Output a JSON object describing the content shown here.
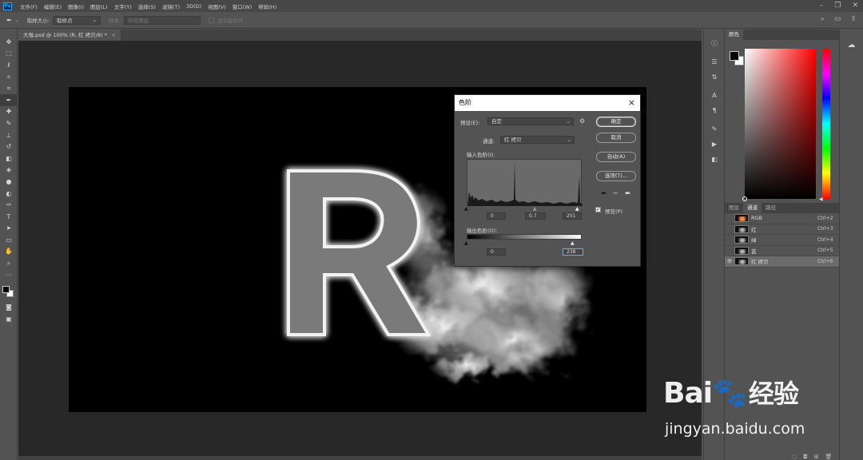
{
  "app": {
    "logo": "Ps",
    "menu": [
      "文件(F)",
      "编辑(E)",
      "图像(I)",
      "图层(L)",
      "文字(Y)",
      "选择(S)",
      "滤镜(T)",
      "3D(D)",
      "视图(V)",
      "窗口(W)",
      "帮助(H)"
    ]
  },
  "options_bar": {
    "sample_size_label": "取样大小:",
    "sample_size_value": "取样点",
    "sample_label": "样本:",
    "sample_value": "所有图层",
    "show_ring": "显示取样环"
  },
  "document": {
    "tab_title": "大咖.psd @ 100% (R, 红 拷贝/8) *",
    "close": "×"
  },
  "tools": [
    "move-icon",
    "marquee-icon",
    "lasso-icon",
    "magic-wand-icon",
    "crop-icon",
    "eyedropper-icon",
    "healing-icon",
    "brush-icon",
    "stamp-icon",
    "history-brush-icon",
    "eraser-icon",
    "bucket-icon",
    "blur-icon",
    "dodge-icon",
    "pen-icon",
    "type-icon",
    "path-select-icon",
    "shape-icon",
    "hand-icon",
    "zoom-icon",
    "more-icon"
  ],
  "color_panel": {
    "tab": "颜色",
    "foreground": "#000000",
    "background": "#ffffff"
  },
  "channels_panel": {
    "tabs": [
      "图层",
      "通道",
      "路径"
    ],
    "active_tab": "通道",
    "rows": [
      {
        "name": "RGB",
        "shortcut": "Ctrl+2",
        "visible": false,
        "selected": false,
        "thumb": "rgb"
      },
      {
        "name": "红",
        "shortcut": "Ctrl+3",
        "visible": false,
        "selected": false,
        "thumb": "gray"
      },
      {
        "name": "绿",
        "shortcut": "Ctrl+4",
        "visible": false,
        "selected": false,
        "thumb": "gray"
      },
      {
        "name": "蓝",
        "shortcut": "Ctrl+5",
        "visible": false,
        "selected": false,
        "thumb": "gray"
      },
      {
        "name": "红 拷贝",
        "shortcut": "Ctrl+6",
        "visible": true,
        "selected": true,
        "thumb": "gray"
      }
    ]
  },
  "levels_dialog": {
    "title": "色阶",
    "close": "×",
    "preset_label": "预设(E):",
    "preset_value": "自定",
    "channel_label": "通道:",
    "channel_value": "红 拷贝",
    "input_label": "输入色阶(I):",
    "input_black": "0",
    "input_gamma": "0.7",
    "input_white": "251",
    "output_label": "输出色阶(O):",
    "output_black": "0",
    "output_white": "238",
    "buttons": {
      "ok": "确定",
      "cancel": "取消",
      "auto": "自动(A)",
      "options": "选项(T)..."
    },
    "preview_label": "预览(P)",
    "preview_checked": true
  },
  "watermark": {
    "brand": "Bai",
    "brand_suffix": "经验",
    "url": "jingyan.baidu.com"
  },
  "colors": {
    "accent": "#31a8ff",
    "panel": "#535353",
    "workspace": "#282828"
  }
}
